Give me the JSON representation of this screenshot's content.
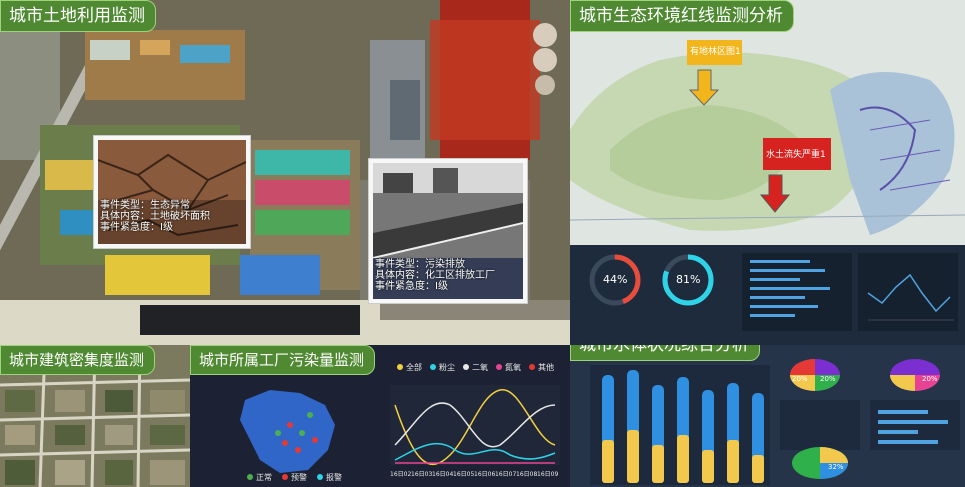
{
  "panels": {
    "land_use": {
      "title": "城市土地利用监测",
      "event1": {
        "type": "事件类型：生态异常",
        "content": "具体内容：土地破坏面积",
        "level": "事件紧急度：I级"
      },
      "event2": {
        "type": "事件类型：污染排放",
        "content": "具体内容：化工区排放工厂",
        "level": "事件紧急度：I级"
      }
    },
    "eco_redline": {
      "title": "城市生态环境红线监测分析",
      "marker1": "有地林区图1",
      "marker2": "水土流失严重1",
      "gauge1": "44%",
      "gauge2": "81%",
      "colors": {
        "marker1": "#f2b51c",
        "marker2": "#d7231f"
      }
    },
    "density": {
      "title": "城市建筑密集度监测"
    },
    "factory": {
      "title": "城市所属工厂污染量监测",
      "legend": [
        "全部",
        "粉尘",
        "二氧",
        "氮氧",
        "其他"
      ],
      "x_labels": [
        "16日02",
        "16日03",
        "16日04",
        "16日05",
        "16日06",
        "16日07",
        "16日08",
        "16日09"
      ],
      "map_legend": [
        "正常",
        "预警",
        "报警"
      ],
      "colors": {
        "yellow": "#f4d03f",
        "pink": "#e84393",
        "cyan": "#2fd3e8",
        "white": "#e8e8e8",
        "red": "#e53935"
      }
    },
    "water": {
      "title": "城市水体状况综合分析",
      "pies": [
        "20%",
        "20%",
        "20%",
        "32%"
      ]
    }
  }
}
